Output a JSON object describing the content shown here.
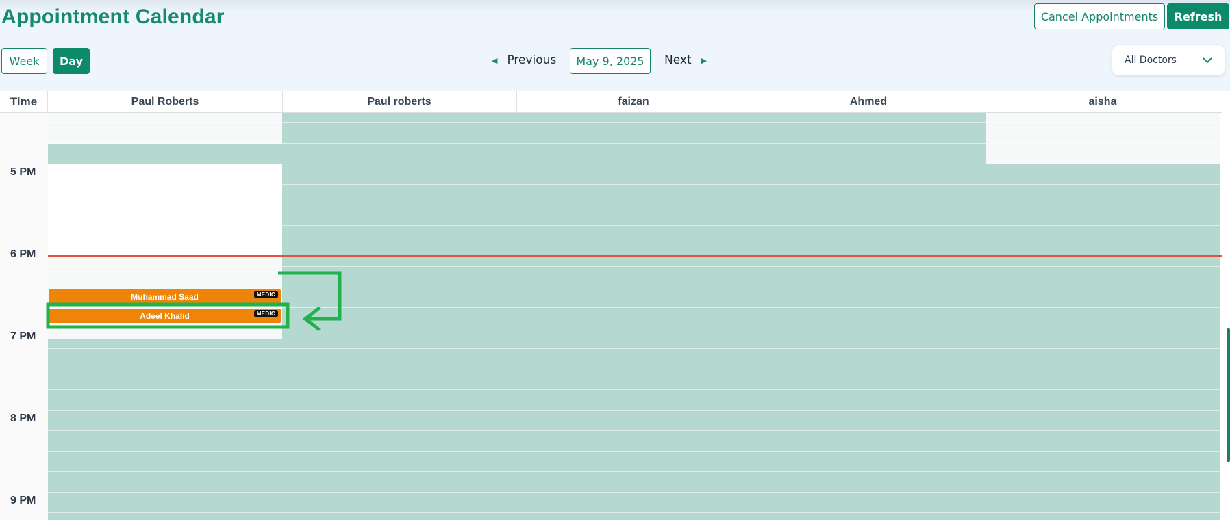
{
  "header": {
    "title": "Appointment Calendar",
    "cancel_label": "Cancel Appointments",
    "refresh_label": "Refresh"
  },
  "view_toggle": {
    "week_label": "Week",
    "day_label": "Day",
    "active": "Day"
  },
  "date_nav": {
    "previous_label": "Previous",
    "current_date": "May 9, 2025",
    "next_label": "Next"
  },
  "doctor_filter": {
    "selected": "All Doctors"
  },
  "calendar": {
    "time_header": "Time",
    "columns": [
      {
        "name": "Paul Roberts"
      },
      {
        "name": "Paul roberts"
      },
      {
        "name": "faizan"
      },
      {
        "name": "Ahmed"
      },
      {
        "name": "aisha"
      }
    ],
    "time_labels": [
      "5 PM",
      "6 PM",
      "7 PM",
      "8 PM",
      "9 PM"
    ],
    "appointments": [
      {
        "patient": "Muhammad Saad",
        "badge": "MEDIC"
      },
      {
        "patient": "Adeel Khalid",
        "badge": "MEDIC"
      }
    ]
  },
  "colors": {
    "brand": "#178a6e",
    "unavailable_slot": "#b5d8d0",
    "appointment": "#ef8508",
    "current_time_line": "#e0533d",
    "annotation": "#22b24c"
  }
}
